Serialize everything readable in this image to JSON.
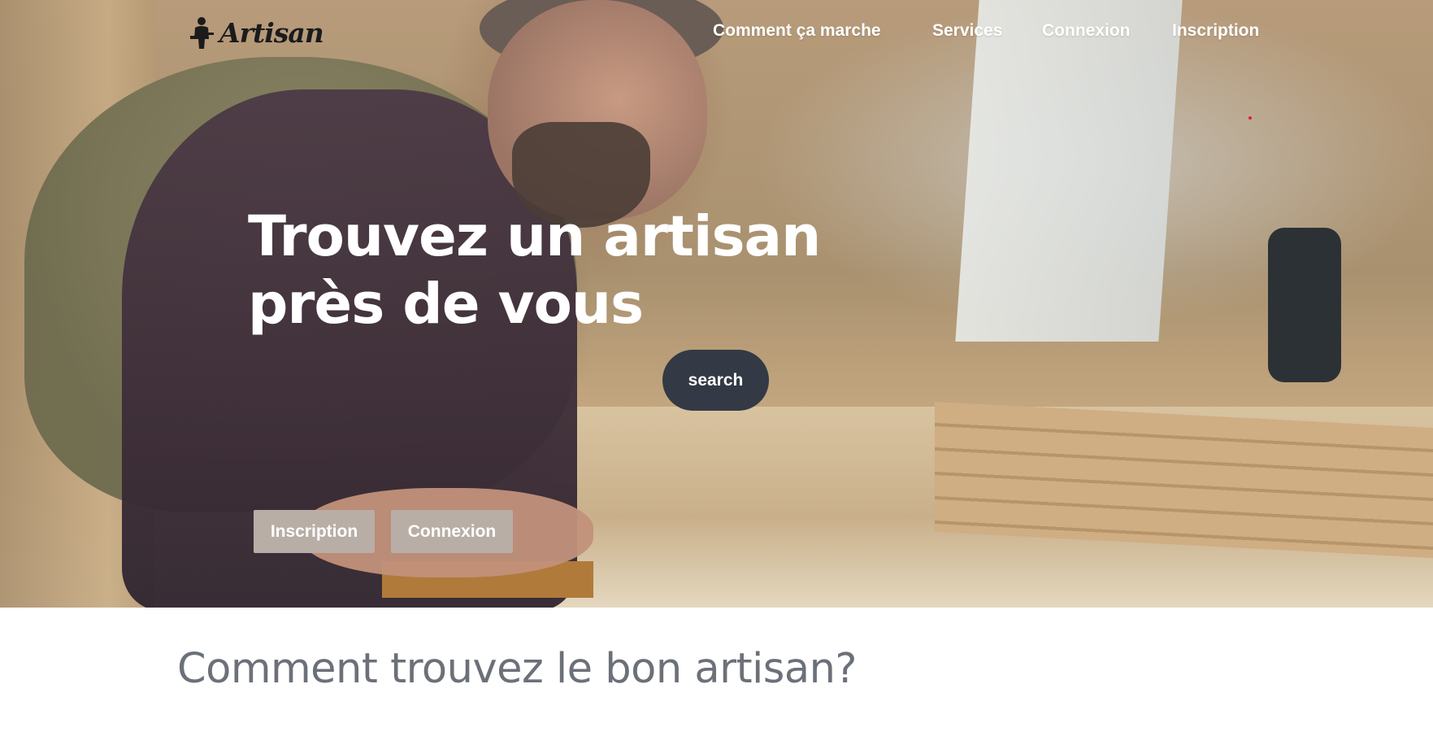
{
  "brand": {
    "name": "Artisan",
    "logo_icon": "craftsman-figure-icon"
  },
  "nav": {
    "items": [
      {
        "label": "Comment ça marche"
      },
      {
        "label": "Services"
      },
      {
        "label": "Connexion"
      },
      {
        "label": "Inscription"
      }
    ]
  },
  "hero": {
    "title_line1": "Trouvez un artisan",
    "title_line2": "près de vous",
    "search_label": "search",
    "buttons": {
      "inscription": "Inscription",
      "connexion": "Connexion"
    }
  },
  "section": {
    "title": "Comment trouvez le bon artisan?"
  },
  "colors": {
    "search_button_bg": "#333a45",
    "cta_button_bg": "#b8aea5",
    "section_title": "#6b7079",
    "nav_text": "#ffffff"
  }
}
